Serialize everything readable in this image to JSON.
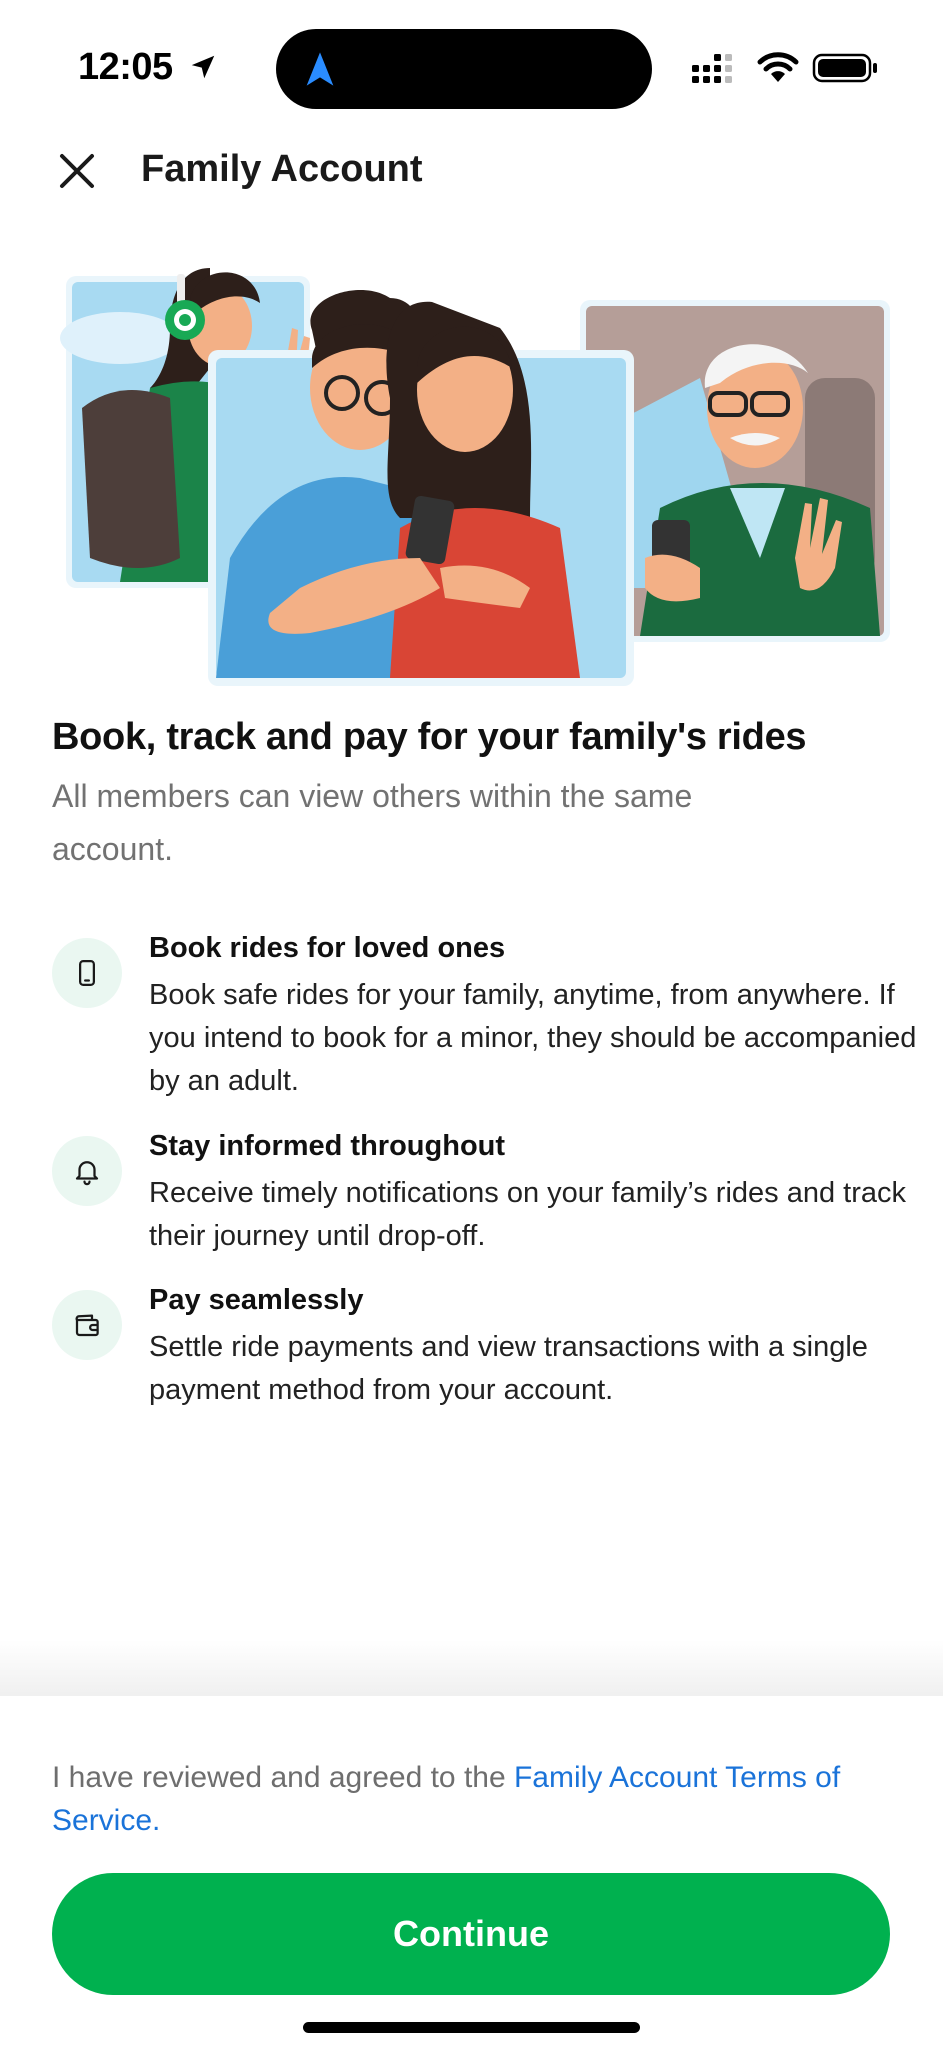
{
  "status_bar": {
    "time": "12:05",
    "icons": [
      "location-arrow-icon",
      "app-navigation-icon",
      "cellular-signal-icon",
      "wifi-icon",
      "battery-icon"
    ]
  },
  "header": {
    "title": "Family Account",
    "close_icon": "close-icon"
  },
  "illustration": {
    "icon": "family-riders-illustration"
  },
  "intro": {
    "headline": "Book, track and pay for your family's rides",
    "subhead": "All members can view others within the same account."
  },
  "features": [
    {
      "icon": "phone-icon",
      "title": "Book rides for loved ones",
      "description": "Book safe rides for your family, anytime, from anywhere. If you intend to book for a minor, they should be accompanied by an adult."
    },
    {
      "icon": "bell-icon",
      "title": "Stay informed throughout",
      "description": "Receive timely notifications on your family’s rides and track their journey until drop-off."
    },
    {
      "icon": "wallet-icon",
      "title": "Pay seamlessly",
      "description": "Settle ride payments and view transactions with a single payment method from your account."
    }
  ],
  "footer": {
    "terms_prefix": "I have reviewed and agreed to the ",
    "terms_link": "Family Account Terms of Service",
    "terms_suffix": ".",
    "continue_label": "Continue"
  },
  "colors": {
    "brand_green": "#00b14f",
    "link_blue": "#1a73d9",
    "icon_bg": "#eaf7f1"
  }
}
